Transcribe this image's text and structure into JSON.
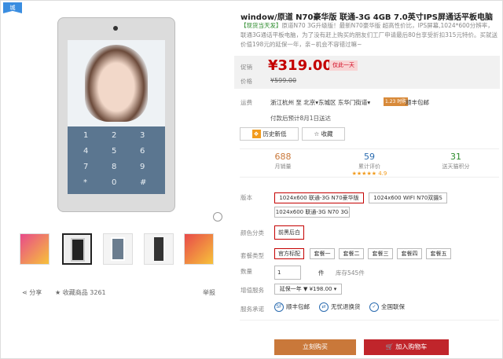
{
  "corner_tag": "城",
  "product": {
    "title": "window/原道 N70豪华版 联通-3G 4GB 7.0英寸IPS屏通话平板电脑",
    "promo_prefix": "【现货当天发】",
    "promo_text": "原道N70 3G升级版！最新N70豪华版 超高性价比，IPS屏幕,1024*600分辨率，联通3G通话平板电脑，为了没有赶上购买的朋友们工厂申请最后80台享受折扣315元特价。买就送价值198元的延保一年，亲~机会不容错过嘛~"
  },
  "price": {
    "sale_label": "促销",
    "sale_price": "¥319.00",
    "badge": "仅此一天",
    "orig_label": "价格",
    "orig_price": "¥599.00"
  },
  "shipping": {
    "label": "运费",
    "route": "浙江杭州 至 北京▾东城区 东华门街道▾",
    "tag": "1.23 时购",
    "freight": "顺丰包邮",
    "note": "付款后预计8月1日送达"
  },
  "actions": {
    "history": "历史新低",
    "favorite": "收藏"
  },
  "stats": [
    {
      "value": "688",
      "label": "月销量"
    },
    {
      "value": "59",
      "label": "累计评价",
      "rating": "★★★★★ 4.9"
    },
    {
      "value": "31",
      "label": "送天猫积分"
    }
  ],
  "options": {
    "version_label": "版本",
    "versions": [
      "1024x600 联通-3G N70豪华版",
      "1024x600 WIFI N70双摄S",
      "1024x600 联通-3G N70 3G"
    ],
    "color_label": "颜色分类",
    "colors": [
      "前黑后白"
    ],
    "package_label": "套餐类型",
    "packages": [
      "官方标配",
      "套餐一",
      "套餐二",
      "套餐三",
      "套餐四",
      "套餐五"
    ],
    "qty_label": "数量",
    "qty": "1",
    "unit": "件",
    "stock": "库存545件",
    "addon_label": "增值服务",
    "addon": "延保一年 ▼ ¥198.00 ▾",
    "service_label": "服务承诺",
    "services": [
      {
        "icon": "SF",
        "text": "顺丰包邮"
      },
      {
        "icon": "⇄",
        "text": "无忧退换货"
      },
      {
        "icon": "✓",
        "text": "全国联保"
      }
    ]
  },
  "buttons": {
    "buy_now": "立刻购买",
    "add_cart": "加入购物车"
  },
  "footer": {
    "share": "分享",
    "collect": "收藏商品",
    "collect_count": "3261",
    "report": "举报"
  },
  "colors": {
    "accent": "#c40000",
    "buy": "#c9783a",
    "cart": "#c0252b"
  }
}
